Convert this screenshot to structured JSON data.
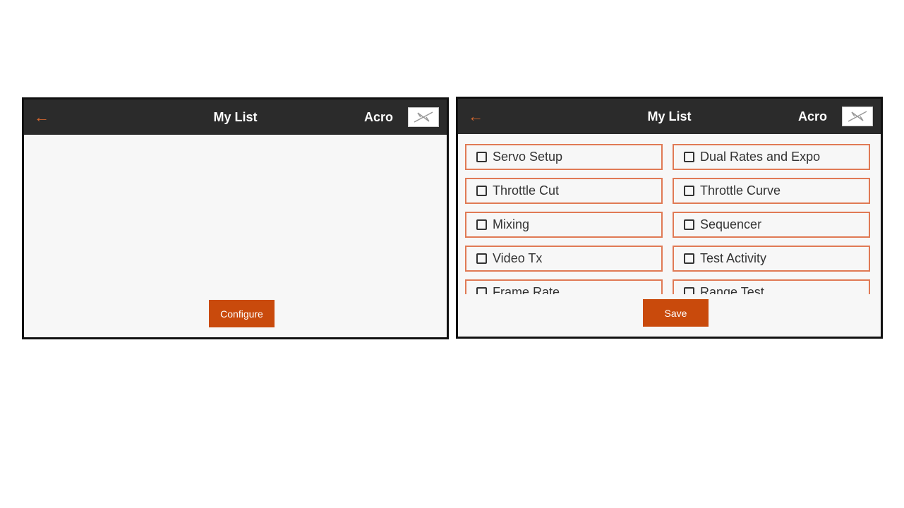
{
  "left_screen": {
    "header": {
      "title": "My List",
      "model": "Acro"
    },
    "configure_label": "Configure"
  },
  "right_screen": {
    "header": {
      "title": "My List",
      "model": "Acro"
    },
    "items": [
      "Servo Setup",
      "Dual Rates and Expo",
      "Throttle Cut",
      "Throttle Curve",
      "Mixing",
      "Sequencer",
      "Video Tx",
      "Test Activity",
      "Frame Rate",
      "Range Test"
    ],
    "checked": [
      false,
      false,
      false,
      false,
      false,
      false,
      false,
      false,
      false,
      false
    ],
    "save_label": "Save"
  },
  "colors": {
    "accent": "#c94a0c",
    "header": "#2b2b2b",
    "item_border": "#e07a55"
  },
  "icons": {
    "back": "arrow-left-icon",
    "model": "airplane-icon"
  }
}
